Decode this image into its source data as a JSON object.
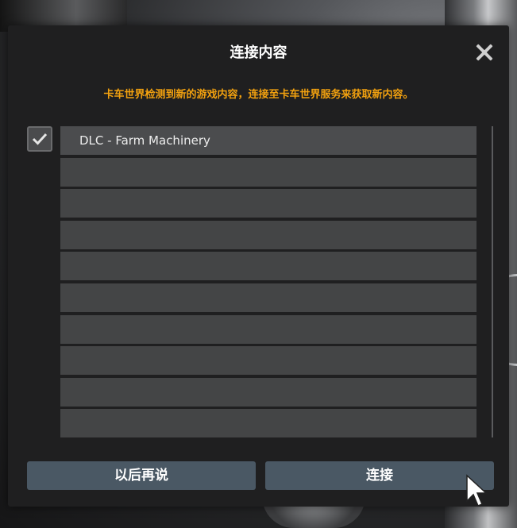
{
  "dialog": {
    "title": "连接内容",
    "notice": "卡车世界检测到新的游戏内容，连接至卡车世界服务来获取新内容。",
    "items": [
      {
        "label": "DLC - Farm Machinery",
        "checked": true
      },
      {
        "label": ""
      },
      {
        "label": ""
      },
      {
        "label": ""
      },
      {
        "label": ""
      },
      {
        "label": ""
      },
      {
        "label": ""
      },
      {
        "label": ""
      },
      {
        "label": ""
      },
      {
        "label": ""
      }
    ],
    "buttons": {
      "later": "以后再说",
      "connect": "连接"
    }
  },
  "colors": {
    "accent": "#f2a10f",
    "button": "#4a5864",
    "panel": "#1f1f20",
    "row": "#444546"
  },
  "icons": {
    "close": "close-icon",
    "check": "check-icon",
    "cursor": "mouse-pointer-icon"
  }
}
